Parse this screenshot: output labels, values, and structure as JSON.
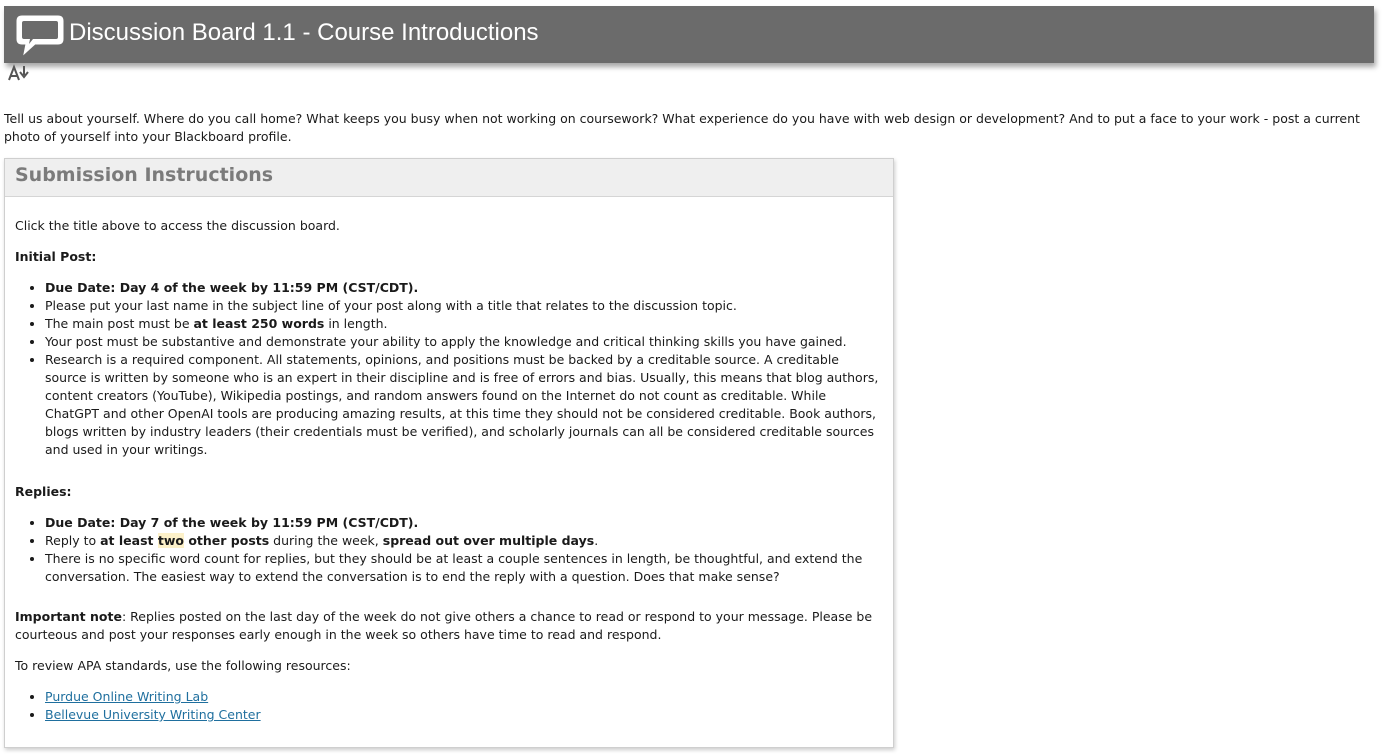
{
  "header": {
    "title": "Discussion Board 1.1 - Course Introductions",
    "icon": "chat-bubble-icon",
    "background": "#6b6b6b"
  },
  "toolbar": {
    "sort_icon": "sort-descending-icon"
  },
  "intro": {
    "text": "Tell us about yourself.  Where do you call home?  What keeps you busy when not working on coursework?  What experience do you have with web design or development?  And to put a face to your work - post a current photo of yourself into your Blackboard profile."
  },
  "panel": {
    "title": "Submission Instructions",
    "click_note": "Click the title above to access the discussion board.",
    "initial_heading": "Initial Post:",
    "initial_items": [
      "Due Date: Day 4 of the week by 11:59 PM (CST/CDT).",
      "Please put your last name in the subject line of your post along with a title that relates to the discussion topic.",
      {
        "pre": "The main post must be ",
        "bold": "at least 250 words",
        "post": " in length."
      },
      "Your post must be substantive and demonstrate your ability to apply the knowledge and critical thinking skills you have gained.",
      "Research is a required component.  All statements, opinions, and positions must be backed by a creditable source.  A creditable source is written by someone who is an expert in their discipline and is free of errors and bias.  Usually, this means that blog authors, content creators (YouTube), Wikipedia postings, and random answers found on the Internet do not count as creditable.  While ChatGPT and other OpenAI tools are producing amazing results, at this time they should not be considered creditable.  Book authors, blogs written by industry leaders (their credentials must be verified), and scholarly journals can all be considered creditable sources and used in your writings."
    ],
    "replies_heading": "Replies:",
    "replies_items": [
      "Due Date: Day 7 of the week by 11:59 PM (CST/CDT).",
      {
        "t1": "Reply to ",
        "b1": "at least ",
        "hl": "two",
        "b2": " other posts",
        "t2": " during the week, ",
        "b3": "spread out over multiple days",
        "t3": "."
      },
      "There is no specific word count for replies, but they should be at least a couple sentences in length, be thoughtful, and extend the conversation.  The easiest way to extend the conversation is to end the reply with a question.  Does that make sense?"
    ],
    "important_label": "Important note",
    "important_text": ": Replies posted on the last day of the week do not give others a chance to read or respond to your message.  Please be courteous and post your responses early enough in the week so others have time to read and respond.",
    "apa_intro": "To review APA standards, use the following resources:",
    "links": [
      "Purdue Online Writing Lab",
      "Bellevue University Writing Center"
    ],
    "link_color": "#1f6f9e"
  }
}
